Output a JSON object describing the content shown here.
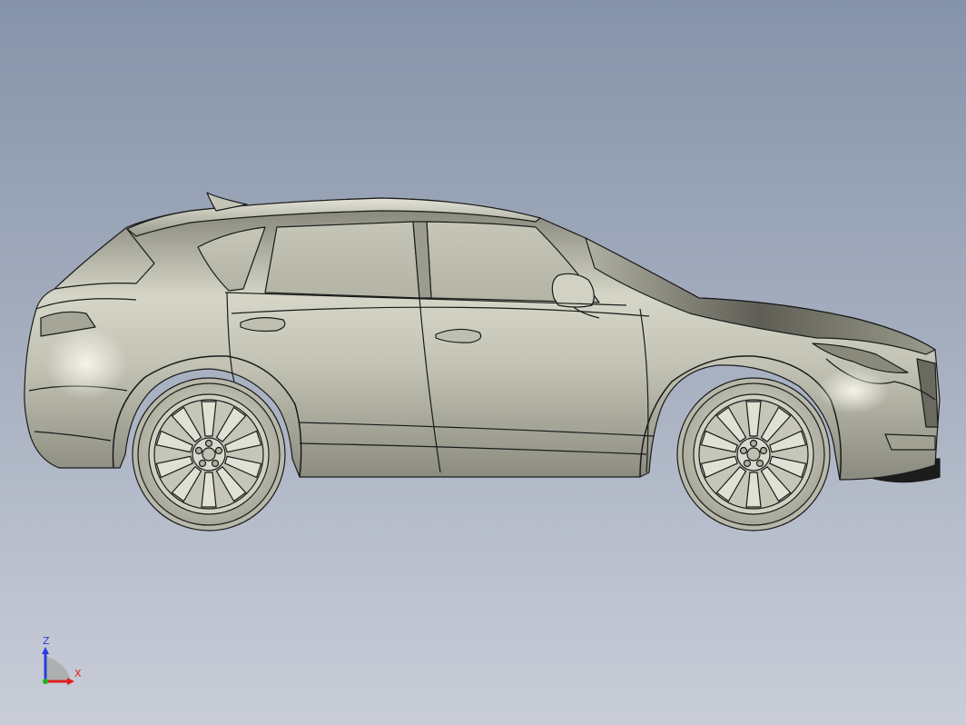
{
  "viewport": {
    "background_top": "#8593a9",
    "background_bottom": "#c9cdd8"
  },
  "model": {
    "icon": "car-suv-side-view",
    "body_color": "#c9c9bb",
    "edge_color": "#1a1a1a",
    "tire_color": "#bdbdae",
    "underbody_color": "#1c1c1c"
  },
  "triad": {
    "z_label": "Z",
    "x_label": "X",
    "z_color": "#2a3ce0",
    "x_color": "#e02020",
    "y_color": "#20b020",
    "origin_color": "#aaaaaa"
  }
}
